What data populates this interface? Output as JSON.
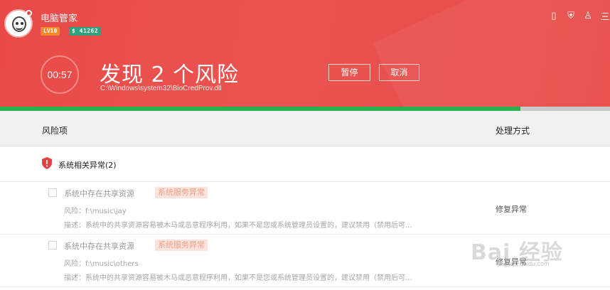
{
  "app": {
    "title": "电脑管家",
    "level": "LV10",
    "coins": "$ 41262"
  },
  "window_controls": {
    "phone": "▯",
    "shield": "⛨",
    "skin": "♙",
    "menu": "三"
  },
  "scan": {
    "timer": "00:57",
    "headline": "发现 2 个风险",
    "path": "C:\\Windows\\system32\\BioCredProv.dll",
    "pause_label": "暂停",
    "cancel_label": "取消",
    "progress": 0.853
  },
  "table": {
    "col_risk": "风险项",
    "col_action": "处理方式"
  },
  "group": {
    "title": "系统相关异常(2)"
  },
  "items": [
    {
      "name": "系统中存在共享资源",
      "tag": "系统服务异常",
      "risk": "风险：f:\\music\\jay",
      "desc": "描述：系统中的共享资源容易被木马或恶意程序利用，如果不是您或系统管理员设置的，建议禁用（禁用后可...",
      "action": "修复异常"
    },
    {
      "name": "系统中存在共享资源",
      "tag": "系统服务异常",
      "risk": "风险：f:\\music\\others",
      "desc": "描述：系统中的共享资源容易被木马或恶意程序利用，如果不是您或系统管理员设置的，建议禁用（禁用后可...",
      "action": "修复异常"
    }
  ],
  "watermark": {
    "brand": "Bai 经验",
    "url": "jingyan.baidu.com"
  },
  "colors": {
    "header_red": "#e94a47",
    "progress_green": "#2cb04f",
    "level_orange": "#f08a2a",
    "coins_green": "#2fa37b",
    "tag_bg": "#fbe3dc"
  }
}
